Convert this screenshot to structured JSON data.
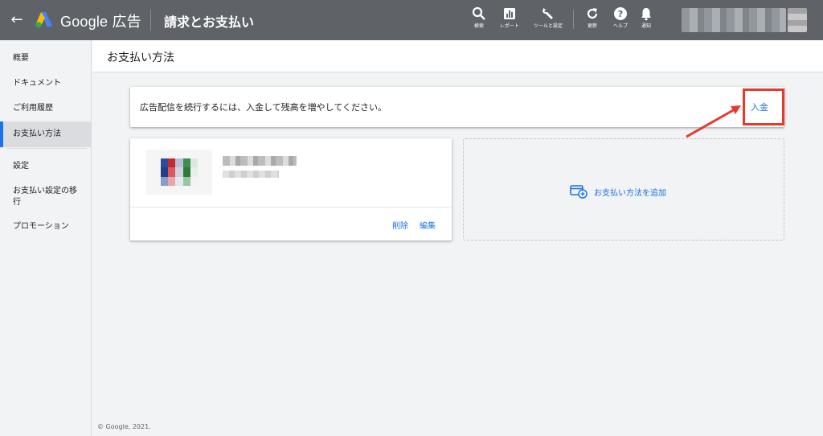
{
  "header": {
    "back_icon": "arrow-back-icon",
    "brand": "Google 広告",
    "page_title": "請求とお支払い",
    "tools": [
      {
        "icon": "search-icon",
        "label": "検索"
      },
      {
        "icon": "report-icon",
        "label": "レポート"
      },
      {
        "icon": "wrench-icon",
        "label": "ツールと設定"
      },
      {
        "icon": "refresh-icon",
        "label": "更新"
      },
      {
        "icon": "help-icon",
        "label": "ヘルプ"
      },
      {
        "icon": "bell-icon",
        "label": "通知"
      }
    ]
  },
  "sidebar": {
    "items": [
      {
        "label": "概要"
      },
      {
        "label": "ドキュメント"
      },
      {
        "label": "ご利用履歴"
      },
      {
        "label": "お支払い方法",
        "active": true
      },
      {
        "label": "設定"
      },
      {
        "label": "お支払い設定の移行"
      },
      {
        "label": "プロモーション"
      }
    ],
    "footer": "© Google, 2021."
  },
  "main": {
    "title": "お支払い方法",
    "notice": {
      "text": "広告配信を続行するには、入金して残高を増やしてください。",
      "link": "入金"
    },
    "payment_card": {
      "delete_label": "削除",
      "edit_label": "編集"
    },
    "add_method_label": "お支払い方法を追加"
  },
  "colors": {
    "topbar": "#5f6368",
    "accent": "#1a73e8",
    "highlight": "#e53b2c"
  }
}
